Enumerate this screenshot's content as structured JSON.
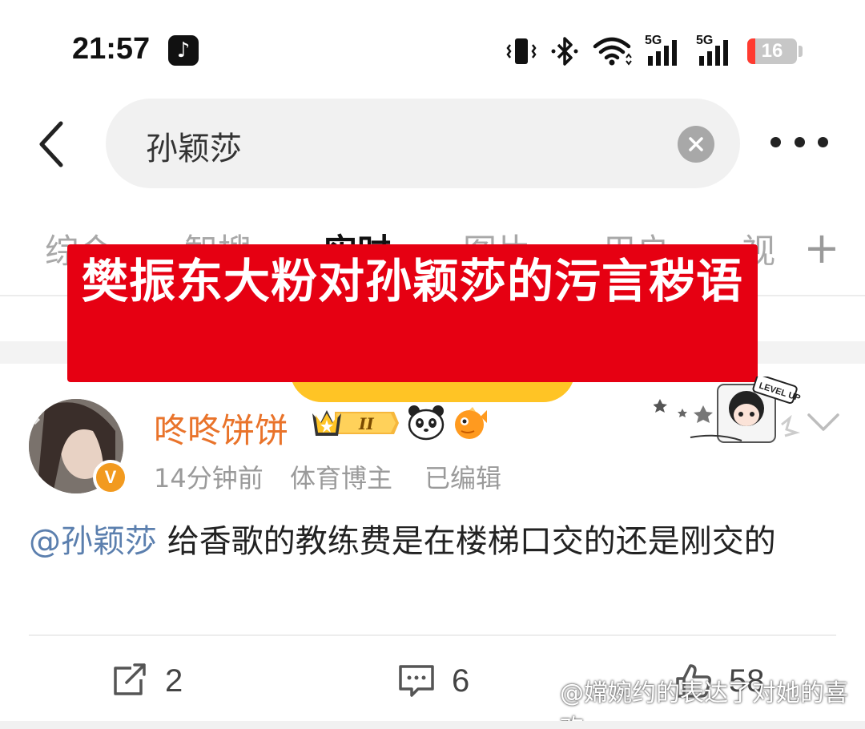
{
  "status_bar": {
    "time": "21:57",
    "app_icon": "tiktok-icon",
    "network_1": "5G",
    "network_2": "5G",
    "battery": "16",
    "battery_level_percent": 16,
    "icons": [
      "vibrate-icon",
      "bluetooth-icon",
      "wifi-icon",
      "signal-icon",
      "signal-icon",
      "battery-icon"
    ]
  },
  "search": {
    "query": "孙颖莎",
    "back_icon": "back-arrow-icon",
    "clear_icon": "clear-icon",
    "more_icon": "more-icon"
  },
  "tabs": [
    {
      "label": "综合"
    },
    {
      "label": "智搜"
    },
    {
      "label": "实时"
    },
    {
      "label": "图片"
    },
    {
      "label": "用户"
    },
    {
      "label": "视"
    }
  ],
  "tabs_add_label": "+",
  "banner": {
    "text": "樊振东大粉对孙颖莎的污言秽语"
  },
  "post": {
    "username": "咚咚饼饼",
    "verified_badge": "V",
    "member_badge": "II",
    "time": "14分钟前",
    "role": "体育博主",
    "edited": "已编辑",
    "mention": "@孙颖莎",
    "content": " 给香歌的教练费是在楼梯口交的还是刚交的",
    "level_badge": "LEVEL UP",
    "actions": {
      "repost_count": "2",
      "comment_count": "6",
      "like_count": "58"
    }
  },
  "watermark": "@嫦婉约的表达了对她的喜欢",
  "colors": {
    "banner_red": "#e60012",
    "username_orange": "#e9732a",
    "mention_blue": "#5b7fae",
    "accent_yellow": "#ffc425"
  }
}
